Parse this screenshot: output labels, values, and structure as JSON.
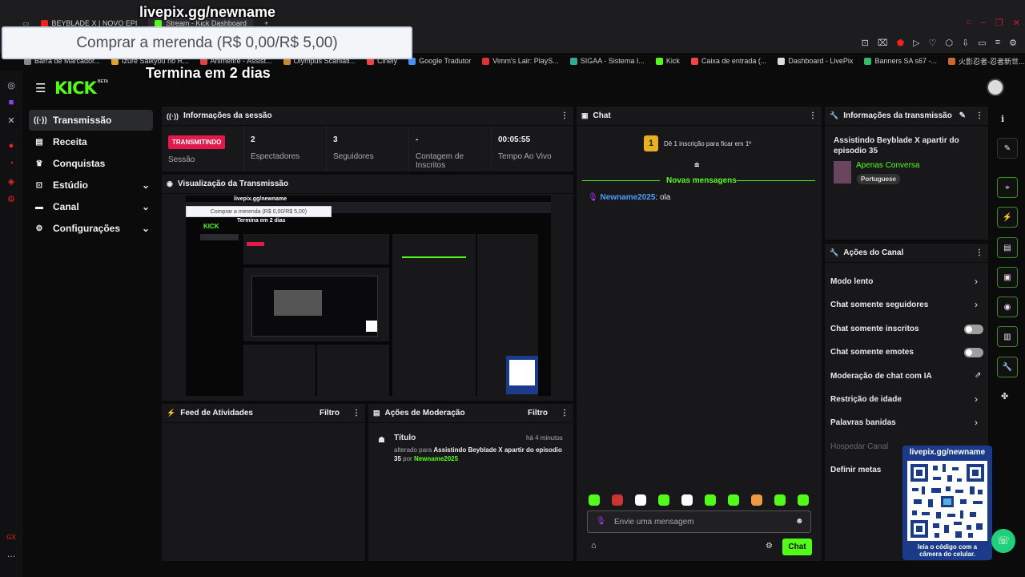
{
  "browser": {
    "tabs": [
      {
        "label": "BEYBLADE X | NOVO EPI",
        "active": false
      },
      {
        "label": "Stream - Kick Dashboard",
        "active": true
      }
    ],
    "new_tab": "+",
    "bookmarks": [
      "Barra de Marcador...",
      "Izure Saikyou no R...",
      "Animefire - Assist...",
      "Olympus Scanlati...",
      "Cinely",
      "Google Tradutor",
      "Vimm's Lair: PlayS...",
      "SIGAA - Sistema I...",
      "Kick",
      "Caixa de entrada (...",
      "Dashboard - LivePix",
      "Banners SA s67 -...",
      "火影忍者-忍者新世..."
    ]
  },
  "overlay": {
    "url": "livepix.gg/newname",
    "goal": "Comprar a merenda (R$ 0,00/R$ 5,00)",
    "ends": "Termina em 2 dias"
  },
  "app": {
    "logo": "KICK",
    "beta": "BETA"
  },
  "sidebar": {
    "items": [
      {
        "label": "Transmissão",
        "icon": "broadcast-icon",
        "active": true,
        "expand": false
      },
      {
        "label": "Receita",
        "icon": "receipt-icon",
        "active": false,
        "expand": false
      },
      {
        "label": "Conquistas",
        "icon": "trophy-icon",
        "active": false,
        "expand": false
      },
      {
        "label": "Estúdio",
        "icon": "studio-icon",
        "active": false,
        "expand": true
      },
      {
        "label": "Canal",
        "icon": "channel-icon",
        "active": false,
        "expand": true
      },
      {
        "label": "Configurações",
        "icon": "gear-icon",
        "active": false,
        "expand": true
      }
    ]
  },
  "session": {
    "title": "Informações da sessão",
    "live_badge": "TRANSMITINDO",
    "session_label": "Sessão",
    "viewers": "2",
    "viewers_label": "Espectadores",
    "followers": "3",
    "followers_label": "Seguidores",
    "subs": "-",
    "subs_label": "Contagem de Inscritos",
    "uptime": "00:05:55",
    "uptime_label": "Tempo Ao Vivo"
  },
  "preview": {
    "title": "Visualização da Transmissão"
  },
  "activity": {
    "title": "Feed de Atividades",
    "filter": "Filtro"
  },
  "moderation": {
    "title": "Ações de Moderação",
    "filter": "Filtro",
    "entry_title": "Título",
    "entry_time": "há 4 minutos",
    "entry_prefix": "alterado para",
    "entry_value": "Assistindo Beyblade X apartir do episodio 35",
    "entry_by": "por",
    "entry_user": "Newname2025"
  },
  "chat": {
    "title": "Chat",
    "sub_rank": "1",
    "sub_prompt": "Dê 1 inscrição para ficar em 1º",
    "new_messages": "Novas mensagens",
    "messages": [
      {
        "user": "Newname2025",
        "text": ": ola"
      }
    ],
    "input_placeholder": "Envie uma mensagem",
    "send": "Chat"
  },
  "stream_info": {
    "title": "Informações da transmissão",
    "stream_title": "Assistindo Beyblade X apartir do episodio 35",
    "category": "Apenas Conversa",
    "language": "Portuguese"
  },
  "channel_actions": {
    "title": "Ações do Canal",
    "items": [
      {
        "label": "Modo lento",
        "control": "chevron"
      },
      {
        "label": "Chat somente seguidores",
        "control": "chevron"
      },
      {
        "label": "Chat somente inscritos",
        "control": "toggle"
      },
      {
        "label": "Chat somente emotes",
        "control": "toggle"
      },
      {
        "label": "Moderação de chat com IA",
        "control": "external"
      },
      {
        "label": "Restrição de idade",
        "control": "chevron"
      },
      {
        "label": "Palavras banidas",
        "control": "chevron"
      },
      {
        "label": "Hospedar Canal",
        "control": "disabled"
      },
      {
        "label": "Definir metas",
        "control": "none"
      }
    ]
  },
  "qr_overlay": {
    "url": "livepix.gg/newname",
    "caption": "leia o código com a câmera do celular."
  },
  "colors": {
    "accent": "#53fc18",
    "live": "#e3184b",
    "panel": "#18181b",
    "qr_card": "#1b3b8a"
  }
}
